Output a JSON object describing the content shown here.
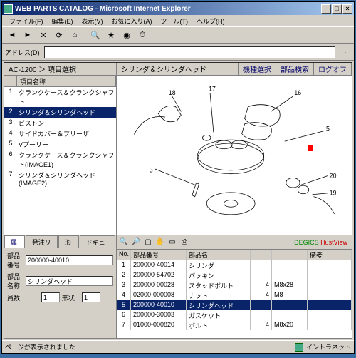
{
  "window": {
    "title": "WEB PARTS CATALOG - Microsoft Internet Explorer"
  },
  "menu": [
    "ファイル(F)",
    "編集(E)",
    "表示(V)",
    "お気に入り(A)",
    "ツール(T)",
    "ヘルプ(H)"
  ],
  "header": {
    "breadcrumb": "AC-1200 ＞ 項目選択",
    "center": "シリンダ＆シリンダヘッド",
    "btns": [
      "機種選択",
      "部品検索",
      "ログオフ"
    ]
  },
  "leftcols": [
    "",
    "項目名称"
  ],
  "leftItems": [
    {
      "n": "1",
      "t": "クランクケース＆クランクシャフト"
    },
    {
      "n": "2",
      "t": "シリンダ＆シリンダヘッド",
      "sel": true
    },
    {
      "n": "3",
      "t": "ピストン"
    },
    {
      "n": "4",
      "t": "サイドカバー＆ブリーザ"
    },
    {
      "n": "5",
      "t": "Vプーリー"
    },
    {
      "n": "6",
      "t": "クランクケース＆クランクシャフト(IMAGE1)"
    },
    {
      "n": "7",
      "t": "シリンダ＆シリンダヘッド(IMAGE2)"
    }
  ],
  "tabs": [
    "属注",
    "発注リスト",
    "形状",
    "ドキュメント"
  ],
  "form": {
    "l1": "部品番号",
    "v1": "200000-40010",
    "l2": "部品名称",
    "v2": "シリンダヘッド",
    "l3": "員数",
    "v3a": "1",
    "l3b": "形状",
    "v3b": "1"
  },
  "tblcols": [
    "No.",
    "部品番号",
    "部品名",
    "",
    "",
    "備考"
  ],
  "rows": [
    {
      "n": "1",
      "pn": "200000-40014",
      "nm": "シリンダ",
      "q": "",
      "r": ""
    },
    {
      "n": "2",
      "pn": "200000-54702",
      "nm": "パッキン",
      "q": "",
      "r": ""
    },
    {
      "n": "3",
      "pn": "200000-00028",
      "nm": "スタッドボルト",
      "q": "4",
      "r": "M8x28"
    },
    {
      "n": "4",
      "pn": "02000-000008",
      "nm": "ナット",
      "q": "4",
      "r": "M8"
    },
    {
      "n": "5",
      "pn": "200000-40010",
      "nm": "シリンダヘッド",
      "q": "",
      "r": "",
      "sel": true
    },
    {
      "n": "6",
      "pn": "200000-30003",
      "nm": "ガスケット",
      "q": "",
      "r": ""
    },
    {
      "n": "7",
      "pn": "01000-000820",
      "nm": "ボルト",
      "q": "4",
      "r": "M8x20"
    }
  ],
  "brand": {
    "a": "DEGICS",
    "b": "IllustView"
  },
  "status": {
    "l": "ページが表示されました",
    "r": "イントラネット"
  },
  "callouts": [
    "3",
    "5",
    "16",
    "17",
    "18",
    "19",
    "20"
  ]
}
